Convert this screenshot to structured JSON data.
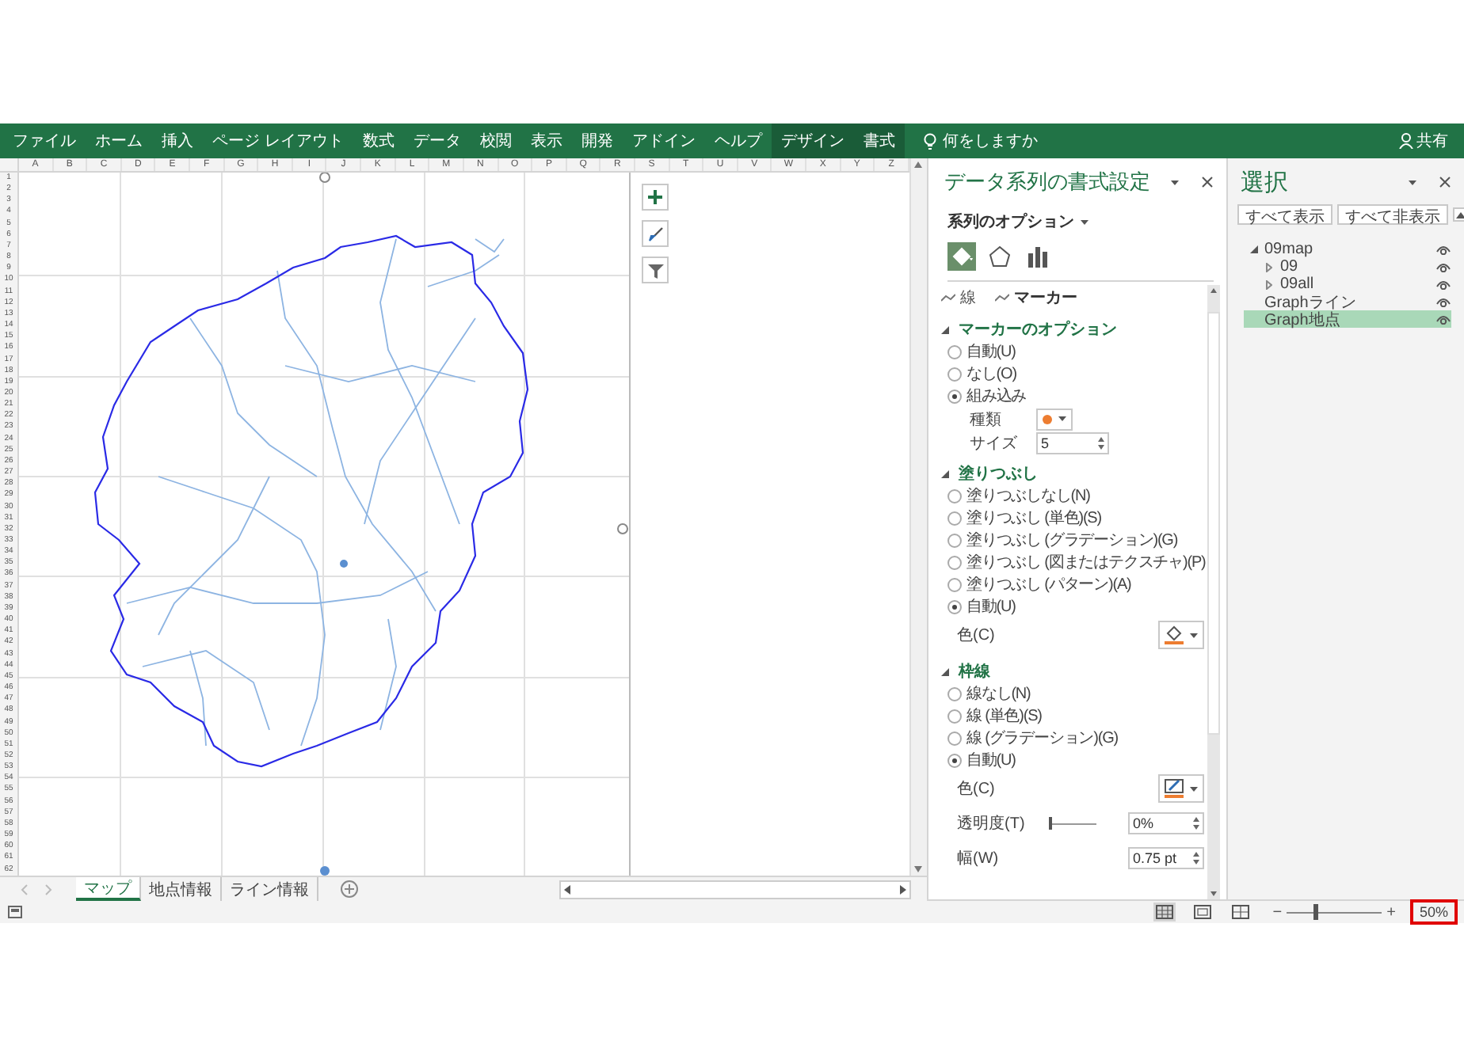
{
  "ribbon": {
    "tabs": [
      {
        "label": "ファイル",
        "contextual": false
      },
      {
        "label": "ホーム",
        "contextual": false
      },
      {
        "label": "挿入",
        "contextual": false
      },
      {
        "label": "ページ レイアウト",
        "contextual": false
      },
      {
        "label": "数式",
        "contextual": false
      },
      {
        "label": "データ",
        "contextual": false
      },
      {
        "label": "校閲",
        "contextual": false
      },
      {
        "label": "表示",
        "contextual": false
      },
      {
        "label": "開発",
        "contextual": false
      },
      {
        "label": "アドイン",
        "contextual": false
      },
      {
        "label": "ヘルプ",
        "contextual": false
      },
      {
        "label": "デザイン",
        "contextual": true
      },
      {
        "label": "書式",
        "contextual": true
      }
    ],
    "tell_me": "何をしますか",
    "share": "共有"
  },
  "sheet": {
    "columns": [
      "A",
      "B",
      "C",
      "D",
      "E",
      "F",
      "G",
      "H",
      "I",
      "J",
      "K",
      "L",
      "M",
      "N",
      "O",
      "P",
      "Q",
      "R",
      "S",
      "T",
      "U",
      "V",
      "W",
      "X",
      "Y",
      "Z"
    ],
    "rows": [
      "1",
      "2",
      "3",
      "4",
      "5",
      "6",
      "7",
      "8",
      "9",
      "10",
      "11",
      "12",
      "13",
      "14",
      "15",
      "16",
      "17",
      "18",
      "19",
      "20",
      "21",
      "22",
      "23",
      "24",
      "25",
      "26",
      "27",
      "28",
      "29",
      "30",
      "31",
      "32",
      "33",
      "34",
      "35",
      "36",
      "37",
      "38",
      "39",
      "40",
      "41",
      "42",
      "43",
      "44",
      "45",
      "46",
      "47",
      "48",
      "49",
      "50",
      "51",
      "52",
      "53",
      "54",
      "55",
      "56",
      "57",
      "58",
      "59",
      "60",
      "61",
      "62"
    ],
    "tabs": [
      {
        "label": "マップ",
        "selected": true
      },
      {
        "label": "地点情報",
        "selected": false
      },
      {
        "label": "ライン情報",
        "selected": false
      }
    ]
  },
  "format_pane": {
    "title": "データ系列の書式設定",
    "options_label": "系列のオプション",
    "icon_tabs": [
      {
        "kind": "fill",
        "selected": true
      },
      {
        "kind": "shape",
        "selected": false
      },
      {
        "kind": "bars",
        "selected": false
      }
    ],
    "subtabs": [
      {
        "label": "線",
        "selected": false
      },
      {
        "label": "マーカー",
        "selected": true
      }
    ],
    "sections": [
      {
        "title": "マーカーのオプション",
        "expanded": true,
        "items": [
          {
            "kind": "radio",
            "label": "自動(U)",
            "checked": false
          },
          {
            "kind": "radio",
            "label": "なし(O)",
            "checked": false
          },
          {
            "kind": "radio",
            "label": "組み込み",
            "checked": true
          },
          {
            "kind": "marker_select",
            "label": "種類"
          },
          {
            "kind": "spin",
            "label": "サイズ",
            "value": "5"
          }
        ]
      },
      {
        "title": "塗りつぶし",
        "expanded": true,
        "items": [
          {
            "kind": "radio",
            "label": "塗りつぶしなし(N)",
            "checked": false
          },
          {
            "kind": "radio",
            "label": "塗りつぶし (単色)(S)",
            "checked": false
          },
          {
            "kind": "radio",
            "label": "塗りつぶし (グラデーション)(G)",
            "checked": false
          },
          {
            "kind": "radio",
            "label": "塗りつぶし (図またはテクスチャ)(P)",
            "checked": false
          },
          {
            "kind": "radio",
            "label": "塗りつぶし (パターン)(A)",
            "checked": false
          },
          {
            "kind": "radio",
            "label": "自動(U)",
            "checked": true
          },
          {
            "kind": "fill_color",
            "label": "色(C)"
          }
        ]
      },
      {
        "title": "枠線",
        "expanded": true,
        "items": [
          {
            "kind": "radio",
            "label": "線なし(N)",
            "checked": false
          },
          {
            "kind": "radio",
            "label": "線 (単色)(S)",
            "checked": false
          },
          {
            "kind": "radio",
            "label": "線 (グラデーション)(G)",
            "checked": false
          },
          {
            "kind": "radio",
            "label": "自動(U)",
            "checked": true
          },
          {
            "kind": "line_color",
            "label": "色(C)"
          },
          {
            "kind": "slider",
            "label": "透明度(T)",
            "level": 0,
            "value": "0%"
          },
          {
            "kind": "spin",
            "label": "幅(W)",
            "value": "0.75 pt"
          }
        ]
      }
    ]
  },
  "selection_pane": {
    "title": "選択",
    "buttons": [
      "すべて表示",
      "すべて非表示"
    ],
    "tree": [
      {
        "label": "09map",
        "expanded": true,
        "selected": false,
        "children": [
          {
            "label": "09",
            "expanded": false,
            "selected": false
          },
          {
            "label": "09all",
            "expanded": false,
            "selected": false
          }
        ]
      },
      {
        "label": "Graphライン",
        "selected": false
      },
      {
        "label": "Graph地点",
        "selected": true
      }
    ]
  },
  "status_bar": {
    "views": [
      {
        "kind": "normal",
        "selected": true
      },
      {
        "kind": "page_layout",
        "selected": false
      },
      {
        "kind": "page_break",
        "selected": false
      }
    ],
    "zoom_out": "−",
    "zoom_in": "+",
    "zoom": {
      "level": 0.3,
      "text": "50%",
      "highlighted": true
    }
  }
}
